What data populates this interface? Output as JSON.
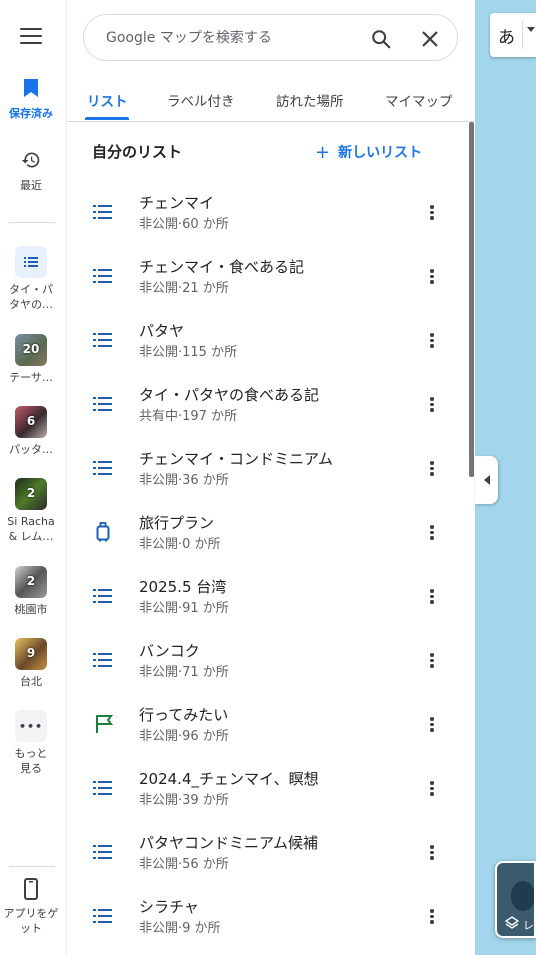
{
  "rail": {
    "saved_label": "保存済み",
    "recent_label": "最近",
    "lists": [
      {
        "label": "タイ・パタヤの…",
        "count": ""
      },
      {
        "label": "テーサ…",
        "count": "20"
      },
      {
        "label": "パッタ…",
        "count": "6"
      },
      {
        "label": "Si Racha & レム…",
        "count": "2"
      },
      {
        "label": "桃園市",
        "count": "2"
      },
      {
        "label": "台北",
        "count": "9"
      }
    ],
    "more_label": "もっと見る",
    "get_app_label": "アプリをゲット"
  },
  "search": {
    "placeholder": "Google マップを検索する"
  },
  "tabs": [
    "リスト",
    "ラベル付き",
    "訪れた場所",
    "マイマップ"
  ],
  "section": {
    "title": "自分のリスト",
    "new_list": "新しいリスト"
  },
  "lists": [
    {
      "title": "チェンマイ",
      "sub": "非公開·60 か所",
      "icon": "list-icon"
    },
    {
      "title": "チェンマイ・食べある記",
      "sub": "非公開·21 か所",
      "icon": "list-icon"
    },
    {
      "title": "パタヤ",
      "sub": "非公開·115 か所",
      "icon": "list-icon"
    },
    {
      "title": "タイ・パタヤの食べある記",
      "sub": "共有中·197 か所",
      "icon": "list-icon"
    },
    {
      "title": "チェンマイ・コンドミニアム",
      "sub": "非公開·36 か所",
      "icon": "list-icon"
    },
    {
      "title": "旅行プラン",
      "sub": "非公開·0 か所",
      "icon": "luggage-icon"
    },
    {
      "title": "2025.5 台湾",
      "sub": "非公開·91 か所",
      "icon": "list-icon"
    },
    {
      "title": "バンコク",
      "sub": "非公開·71 か所",
      "icon": "list-icon"
    },
    {
      "title": "行ってみたい",
      "sub": "非公開·96 か所",
      "icon": "flag-icon"
    },
    {
      "title": "2024.4_チェンマイ、瞑想",
      "sub": "非公開·39 か所",
      "icon": "list-icon"
    },
    {
      "title": "パタヤコンドミニアム候補",
      "sub": "非公開·56 か所",
      "icon": "list-icon"
    },
    {
      "title": "シラチャ",
      "sub": "非公開·9 か所",
      "icon": "list-icon"
    }
  ],
  "map": {
    "ime_char": "あ",
    "layers_label": "レ"
  },
  "colors": {
    "accent": "#1a73e8",
    "list_icon": "#1a5fb4",
    "flag_icon": "#188038",
    "map_water": "#aadaff"
  }
}
